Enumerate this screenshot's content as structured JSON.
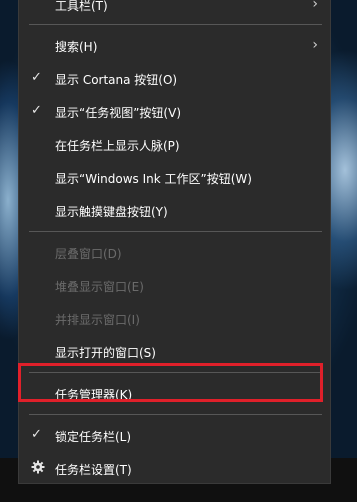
{
  "menu": {
    "toolbar": "工具栏(T)",
    "search": "搜索(H)",
    "show_cortana": "显示 Cortana 按钮(O)",
    "show_task_view": "显示“任务视图”按钮(V)",
    "show_people": "在任务栏上显示人脉(P)",
    "show_ink": "显示“Windows Ink 工作区”按钮(W)",
    "show_touch_keyboard": "显示触摸键盘按钮(Y)",
    "cascade": "层叠窗口(D)",
    "stacked": "堆叠显示窗口(E)",
    "side_by_side": "并排显示窗口(I)",
    "show_open_windows": "显示打开的窗口(S)",
    "task_manager": "任务管理器(K)",
    "lock_taskbar": "锁定任务栏(L)",
    "taskbar_settings": "任务栏设置(T)"
  },
  "icons": {
    "check": "✓",
    "chevron": "›",
    "gear": "gear-icon"
  },
  "colors": {
    "menu_bg": "#2b2b2b",
    "highlight_border": "#e0202a",
    "disabled_text": "#6b6b6b"
  }
}
